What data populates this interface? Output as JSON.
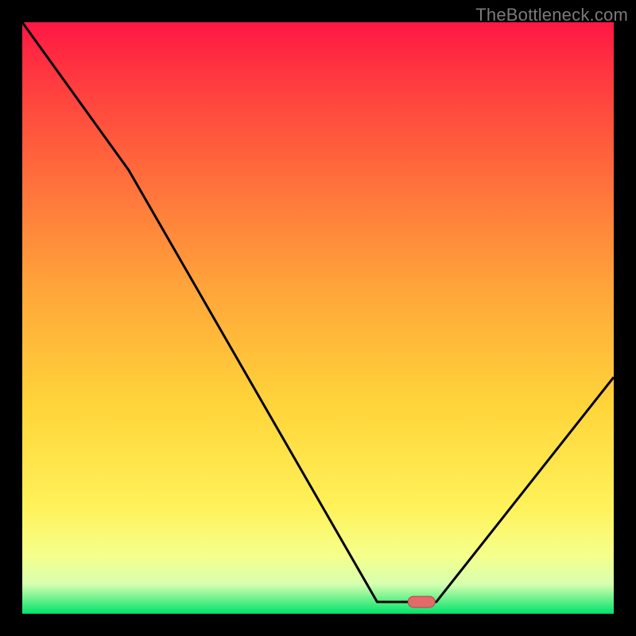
{
  "watermark": "TheBottleneck.com",
  "chart_data": {
    "type": "line",
    "title": "",
    "xlabel": "",
    "ylabel": "",
    "xlim": [
      0,
      100
    ],
    "ylim": [
      0,
      100
    ],
    "x": [
      0,
      18,
      60,
      65,
      70,
      100
    ],
    "values": [
      100,
      75,
      2,
      2,
      2,
      40
    ],
    "marker": {
      "x": 67.5,
      "y": 2
    },
    "gradient_stops": [
      {
        "pos": 0.0,
        "color": "#ff1744"
      },
      {
        "pos": 0.1,
        "color": "#ff3b3f"
      },
      {
        "pos": 0.25,
        "color": "#ff6a3c"
      },
      {
        "pos": 0.45,
        "color": "#ffa53a"
      },
      {
        "pos": 0.65,
        "color": "#ffd53a"
      },
      {
        "pos": 0.82,
        "color": "#fff25a"
      },
      {
        "pos": 0.9,
        "color": "#f6ff8a"
      },
      {
        "pos": 0.95,
        "color": "#d7ffb0"
      },
      {
        "pos": 1.0,
        "color": "#00e36b"
      }
    ],
    "line_color": "#000000",
    "line_width": 3,
    "marker_fill": "#e26a6a",
    "marker_stroke": "#b84646"
  }
}
